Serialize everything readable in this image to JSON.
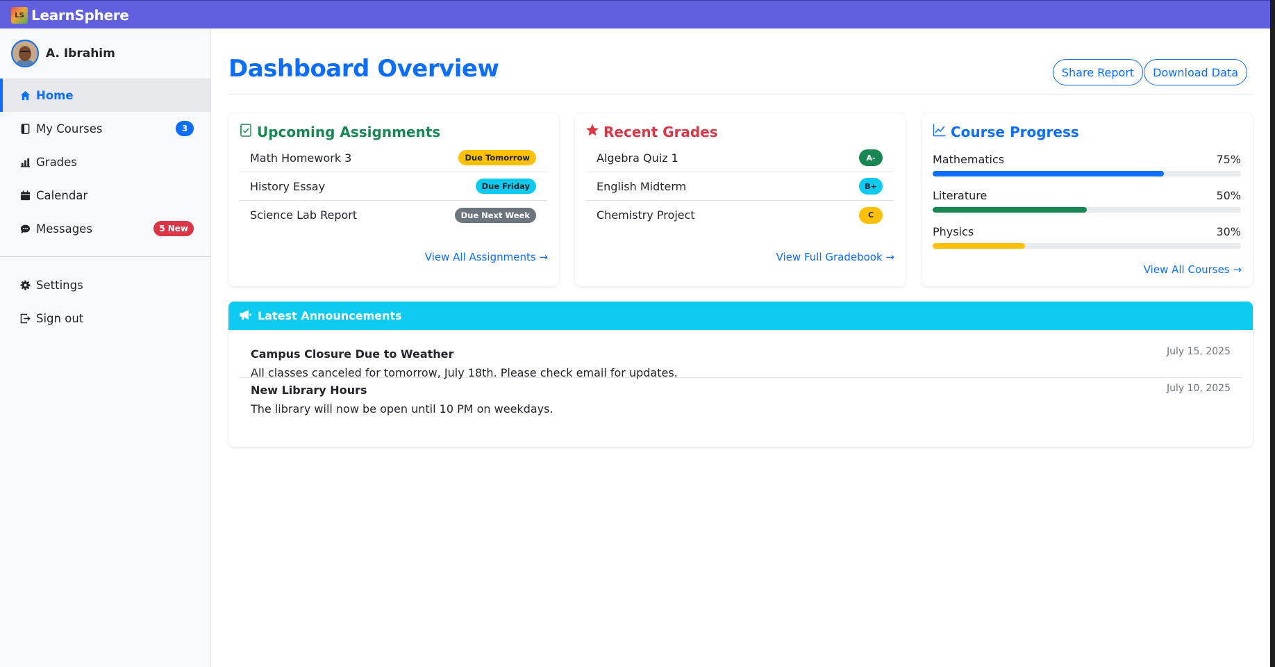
{
  "app": {
    "logo_text": "LS",
    "name": "LearnSphere"
  },
  "user": {
    "name": "A. Ibrahim"
  },
  "sidebar": {
    "items": [
      {
        "label": "Home",
        "icon": "home-icon",
        "active": true
      },
      {
        "label": "My Courses",
        "icon": "book-icon",
        "badge": "3",
        "badge_color": "#0d6efd"
      },
      {
        "label": "Grades",
        "icon": "bar-chart-icon"
      },
      {
        "label": "Calendar",
        "icon": "calendar-icon"
      },
      {
        "label": "Messages",
        "icon": "chat-icon",
        "badge": "5 New",
        "badge_color": "#dc3545"
      }
    ],
    "bottom_items": [
      {
        "label": "Settings",
        "icon": "gear-icon"
      },
      {
        "label": "Sign out",
        "icon": "sign-out-icon"
      }
    ]
  },
  "header": {
    "title": "Dashboard Overview",
    "share_label": "Share Report",
    "download_label": "Download Data"
  },
  "assignments": {
    "title": "Upcoming Assignments",
    "title_color": "#198754",
    "items": [
      {
        "name": "Math Homework 3",
        "badge": "Due Tomorrow",
        "badge_bg": "#ffc107",
        "badge_fg": "#212529"
      },
      {
        "name": "History Essay",
        "badge": "Due Friday",
        "badge_bg": "#0dcaf0",
        "badge_fg": "#212529"
      },
      {
        "name": "Science Lab Report",
        "badge": "Due Next Week",
        "badge_bg": "#6c757d",
        "badge_fg": "#ffffff"
      }
    ],
    "link": "View All Assignments →"
  },
  "grades": {
    "title": "Recent Grades",
    "title_color": "#dc3545",
    "items": [
      {
        "name": "Algebra Quiz 1",
        "grade": "A-",
        "bg": "#198754",
        "fg": "#ffffff"
      },
      {
        "name": "English Midterm",
        "grade": "B+",
        "bg": "#0dcaf0",
        "fg": "#212529"
      },
      {
        "name": "Chemistry Project",
        "grade": "C",
        "bg": "#ffc107",
        "fg": "#212529"
      }
    ],
    "link": "View Full Gradebook →"
  },
  "progress": {
    "title": "Course Progress",
    "title_color": "#0d6efd",
    "items": [
      {
        "name": "Mathematics",
        "percent": "75%",
        "value": 0.75,
        "color": "#0d6efd"
      },
      {
        "name": "Literature",
        "percent": "50%",
        "value": 0.5,
        "color": "#198754"
      },
      {
        "name": "Physics",
        "percent": "30%",
        "value": 0.3,
        "color": "#ffc107"
      }
    ],
    "link": "View All Courses →"
  },
  "announcements": {
    "title": "Latest Announcements",
    "items": [
      {
        "title": "Campus Closure Due to Weather",
        "text": "All classes canceled for tomorrow, July 18th. Please check email for updates.",
        "date": "July 15, 2025"
      },
      {
        "title": "New Library Hours",
        "text": "The library will now be open until 10 PM on weekdays.",
        "date": "July 10, 2025"
      }
    ]
  }
}
